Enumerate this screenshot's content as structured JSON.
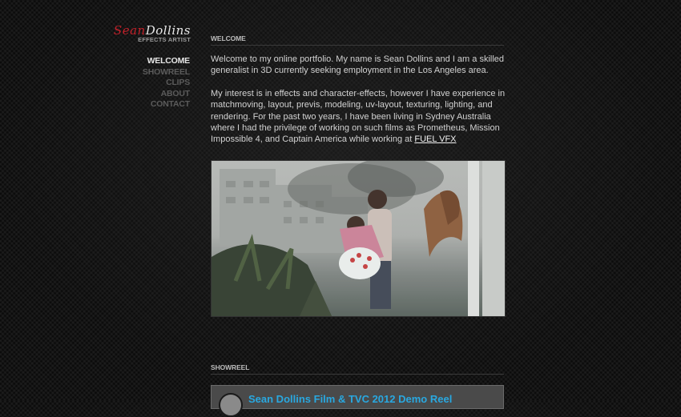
{
  "logo": {
    "name_first": "Sean",
    "name_last": "Dollins",
    "subtitle": "EFFECTS ARTIST",
    "accent_color": "#c3212a"
  },
  "nav": {
    "items": [
      {
        "label": "WELCOME",
        "active": true
      },
      {
        "label": "SHOWREEL",
        "active": false
      },
      {
        "label": "CLIPS",
        "active": false
      },
      {
        "label": "ABOUT",
        "active": false
      },
      {
        "label": "CONTACT",
        "active": false
      }
    ]
  },
  "welcome": {
    "heading": "WELCOME",
    "paragraph1": "Welcome to my online portfolio. My name is Sean Dollins and I am a skilled generalist in 3D currently seeking employment in the Los Angeles area.",
    "paragraph2_text": "My interest is in effects and character-effects, however I have experience in matchmoving, layout, previs, modeling, uv-layout, texturing, lighting, and rendering. For the past two years, I have been living in Sydney Australia where I had the privilege of working on such films as Prometheus, Mission Impossible 4, and Captain America while working at ",
    "paragraph2_link": "FUEL VFX"
  },
  "showreel": {
    "heading": "SHOWREEL",
    "video_title": "Sean Dollins Film & TVC 2012 Demo Reel",
    "video_title_color": "#29a8e0"
  }
}
